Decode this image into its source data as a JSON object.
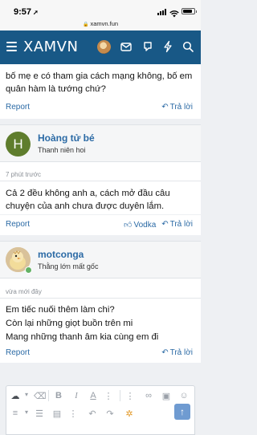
{
  "status_bar": {
    "time": "9:57",
    "url": "xamvn.fun"
  },
  "nav": {
    "logo": "XAMVN"
  },
  "posts": [
    {
      "text": "bố mẹ e có tham gia cách mạng không, bố em quân hàm là tướng chứ?",
      "report": "Report",
      "reply": "Trả lời"
    },
    {
      "avatar_letter": "H",
      "username": "Hoàng tử bé",
      "user_title": "Thanh niên hoi",
      "time": "7 phút trước",
      "text": "Cả 2 đều không anh a, cách mở đầu câu chuyện của anh chưa được duyên lắm.",
      "report": "Report",
      "like": "Vodka",
      "reply": "Trả lời"
    },
    {
      "username": "motconga",
      "user_title": "Thằng lớn mất gốc",
      "time": "vừa mới đây",
      "lines": [
        "Em tiếc nuối thêm làm chi?",
        "Còn lại những giọt buồn trên mi",
        "Mang những thanh âm kia cùng em đi"
      ],
      "report": "Report",
      "reply": "Trả lời"
    }
  ],
  "editor": {
    "toolbar_row1": [
      "upload-icon",
      "eraser-icon",
      "bold-icon",
      "italic-icon",
      "text-color-icon",
      "more-text-icon",
      "link-icon",
      "image-icon",
      "smiley-icon"
    ],
    "toolbar_row2": [
      "list-icon",
      "align-icon",
      "media-icon",
      "undo-icon",
      "redo-icon",
      "settings-icon"
    ]
  }
}
